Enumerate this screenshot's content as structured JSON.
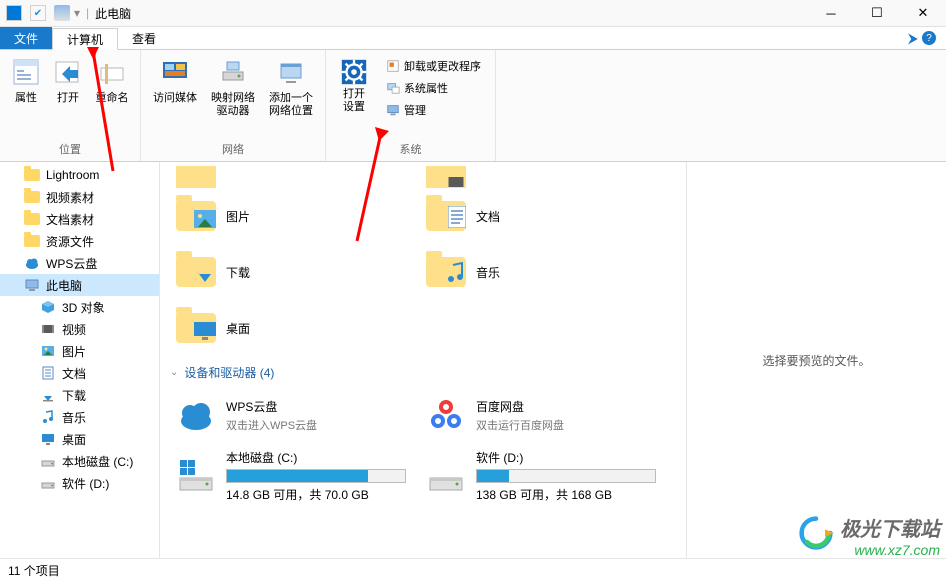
{
  "title_bar": {
    "app_title": "此电脑"
  },
  "tabs": {
    "file": "文件",
    "computer": "计算机",
    "view": "查看"
  },
  "ribbon": {
    "group_location": {
      "label": "位置",
      "properties": "属性",
      "open": "打开",
      "rename": "重命名"
    },
    "group_network": {
      "label": "网络",
      "media": "访问媒体",
      "map_drive": "映射网络\n驱动器",
      "add_loc": "添加一个\n网络位置"
    },
    "group_system": {
      "label": "系统",
      "open_settings": "打开\n设置",
      "uninstall": "卸载或更改程序",
      "sys_props": "系统属性",
      "manage": "管理"
    }
  },
  "sidebar": {
    "items": [
      {
        "name": "Lightroom",
        "type": "folder"
      },
      {
        "name": "视频素材",
        "type": "folder"
      },
      {
        "name": "文档素材",
        "type": "folder"
      },
      {
        "name": "资源文件",
        "type": "folder"
      },
      {
        "name": "WPS云盘",
        "type": "cloud"
      },
      {
        "name": "此电脑",
        "type": "pc",
        "selected": true
      },
      {
        "name": "3D 对象",
        "type": "3d",
        "sub": true
      },
      {
        "name": "视频",
        "type": "video",
        "sub": true
      },
      {
        "name": "图片",
        "type": "picture",
        "sub": true
      },
      {
        "name": "文档",
        "type": "doc",
        "sub": true
      },
      {
        "name": "下载",
        "type": "download",
        "sub": true
      },
      {
        "name": "音乐",
        "type": "music",
        "sub": true
      },
      {
        "name": "桌面",
        "type": "desktop",
        "sub": true
      },
      {
        "name": "本地磁盘 (C:)",
        "type": "drive",
        "sub": true
      },
      {
        "name": "软件 (D:)",
        "type": "drive",
        "sub": true
      }
    ]
  },
  "content": {
    "folders": [
      {
        "name": "图片",
        "overlay": "picture"
      },
      {
        "name": "文档",
        "overlay": "doc"
      },
      {
        "name": "下载",
        "overlay": "download"
      },
      {
        "name": "音乐",
        "overlay": "music"
      },
      {
        "name": "桌面",
        "overlay": "desktop"
      }
    ],
    "category": {
      "label": "设备和驱动器 (4)"
    },
    "cloud_drives": [
      {
        "name": "WPS云盘",
        "sub": "双击进入WPS云盘",
        "type": "wps"
      },
      {
        "name": "百度网盘",
        "sub": "双击运行百度网盘",
        "type": "baidu"
      }
    ],
    "drives": [
      {
        "name": "本地磁盘 (C:)",
        "free_text": "14.8 GB 可用，共 70.0 GB",
        "fill": 79,
        "os": true
      },
      {
        "name": "软件 (D:)",
        "free_text": "138 GB 可用，共 168 GB",
        "fill": 18,
        "os": false
      }
    ]
  },
  "preview": {
    "empty": "选择要预览的文件。"
  },
  "status": {
    "count": "11 个项目"
  },
  "watermark": {
    "name": "极光下载站",
    "url": "www.xz7.com"
  }
}
